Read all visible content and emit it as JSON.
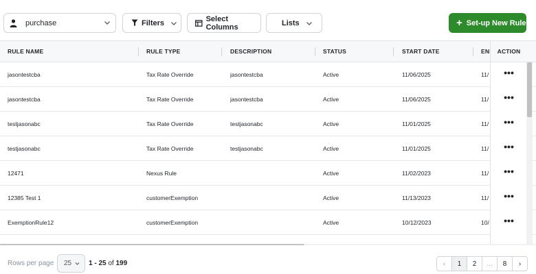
{
  "toolbar": {
    "profile_dropdown": {
      "icon": "person-icon",
      "value": "purchase"
    },
    "filters_label": "Filters",
    "select_columns_label": "Select Columns",
    "lists_label": "Lists",
    "new_rule_label": "Set-up New Rule",
    "accent_color": "#2e8b2c"
  },
  "table": {
    "columns": [
      "RULE NAME",
      "RULE TYPE",
      "DESCRIPTION",
      "STATUS",
      "START DATE",
      "END",
      "ACTION"
    ],
    "rows": [
      {
        "name": "jasontestcba",
        "type": "Tax Rate Override",
        "description": "jasontestcba",
        "status": "Active",
        "start_date": "11/06/2025",
        "end_date": "11/"
      },
      {
        "name": "jasontestcba",
        "type": "Tax Rate Override",
        "description": "jasontestcba",
        "status": "Active",
        "start_date": "11/06/2025",
        "end_date": "11/"
      },
      {
        "name": "testjasonabc",
        "type": "Tax Rate Override",
        "description": "testjasonabc",
        "status": "Active",
        "start_date": "11/01/2025",
        "end_date": "11/"
      },
      {
        "name": "testjasonabc",
        "type": "Tax Rate Override",
        "description": "testjasonabc",
        "status": "Active",
        "start_date": "11/01/2025",
        "end_date": "11/"
      },
      {
        "name": "12471",
        "type": "Nexus Rule",
        "description": "",
        "status": "Active",
        "start_date": "11/02/2023",
        "end_date": "11/"
      },
      {
        "name": "12385 Test 1",
        "type": "customerExemption",
        "description": "",
        "status": "Active",
        "start_date": "11/13/2023",
        "end_date": "11/"
      },
      {
        "name": "ExemptionRule12",
        "type": "customerExemption",
        "description": "",
        "status": "Active",
        "start_date": "10/12/2023",
        "end_date": "10/"
      }
    ],
    "action_glyph": "•••"
  },
  "footer": {
    "rows_per_page_label": "Rows per page",
    "rows_per_page_value": "25",
    "range_label": "1 - 25",
    "of_label": "of",
    "total": "199",
    "pages": [
      "1",
      "2",
      "...",
      "8"
    ],
    "prev_glyph": "‹",
    "next_glyph": "›"
  }
}
